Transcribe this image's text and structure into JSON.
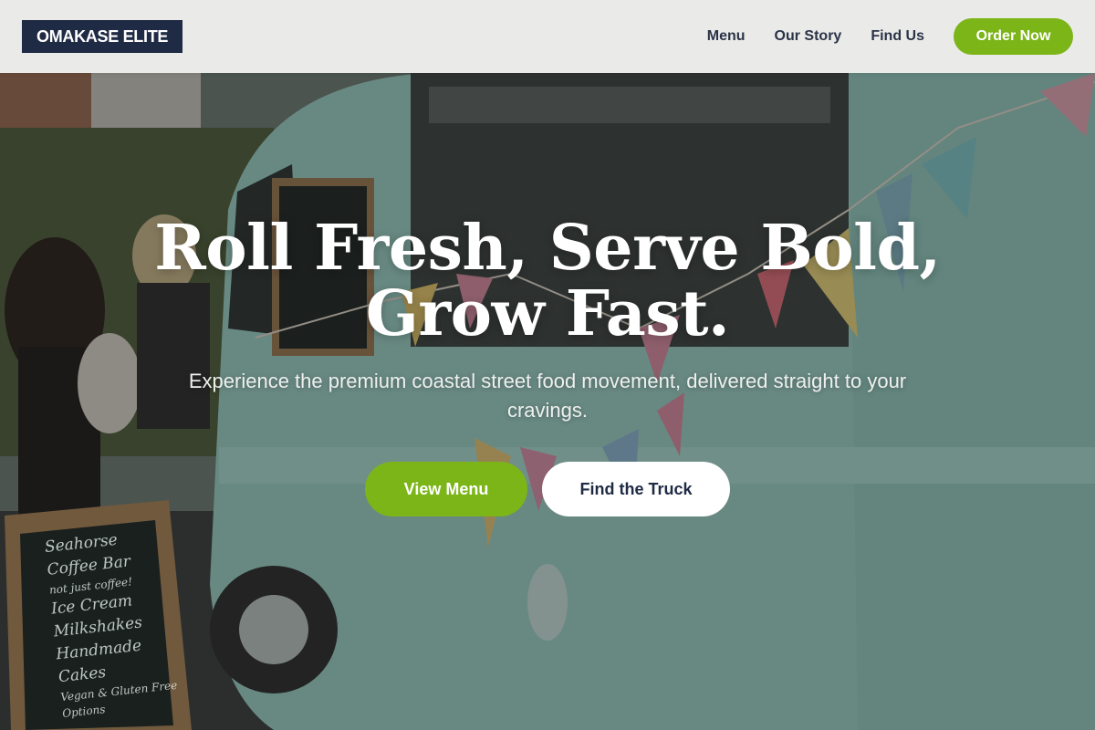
{
  "header": {
    "logo_text": "OMAKASE ELITE",
    "nav": [
      {
        "label": "Menu"
      },
      {
        "label": "Our Story"
      },
      {
        "label": "Find Us"
      }
    ],
    "cta_label": "Order Now"
  },
  "hero": {
    "headline_line1": "Roll Fresh, Serve Bold,",
    "headline_line2": "Grow Fast.",
    "subtitle": "Experience the premium coastal street food movement, delivered straight to your cravings.",
    "primary_cta": "View Menu",
    "secondary_cta": "Find the Truck"
  },
  "background": {
    "chalkboard_sign": {
      "lines": [
        "Seahorse",
        "Coffee Bar",
        "not just coffee!",
        "Ice Cream",
        "Milkshakes",
        "Handmade Cakes",
        "Vegan & Gluten Free Options"
      ]
    }
  },
  "colors": {
    "brand_navy": "#1f2a44",
    "accent_green": "#7cb518",
    "header_bg": "#f0f0ee",
    "truck_mint": "#9ccfc6"
  }
}
